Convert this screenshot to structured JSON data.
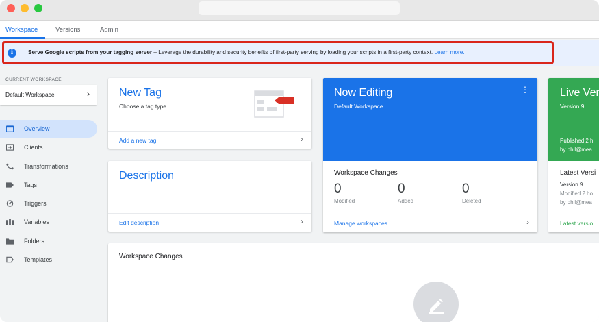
{
  "tabs": [
    {
      "label": "Workspace"
    },
    {
      "label": "Versions"
    },
    {
      "label": "Admin"
    }
  ],
  "banner": {
    "bold_text": "Serve Google scripts from your tagging server",
    "body_text": " – Leverage the durability and security benefits of first-party serving by loading your scripts in a first-party context. ",
    "link_text": "Learn more."
  },
  "sidebar": {
    "workspace_label": "CURRENT WORKSPACE",
    "workspace_name": "Default Workspace",
    "items": [
      {
        "label": "Overview",
        "icon": "overview-icon"
      },
      {
        "label": "Clients",
        "icon": "clients-icon"
      },
      {
        "label": "Transformations",
        "icon": "transformations-icon"
      },
      {
        "label": "Tags",
        "icon": "tag-icon"
      },
      {
        "label": "Triggers",
        "icon": "trigger-icon"
      },
      {
        "label": "Variables",
        "icon": "variables-icon"
      },
      {
        "label": "Folders",
        "icon": "folder-icon"
      },
      {
        "label": "Templates",
        "icon": "template-icon"
      }
    ]
  },
  "new_tag": {
    "title": "New Tag",
    "subtitle": "Choose a tag type",
    "footer_link": "Add a new tag"
  },
  "description": {
    "title": "Description",
    "footer_link": "Edit description"
  },
  "now_editing": {
    "title": "Now Editing",
    "subtitle": "Default Workspace",
    "changes_title": "Workspace Changes",
    "counters": [
      {
        "value": "0",
        "label": "Modified"
      },
      {
        "value": "0",
        "label": "Added"
      },
      {
        "value": "0",
        "label": "Deleted"
      }
    ],
    "footer_link": "Manage workspaces"
  },
  "live_version": {
    "title": "Live Ver",
    "subtitle": "Version 9",
    "published": "Published 2 h",
    "by": "by phil@mea",
    "latest_title": "Latest Versi",
    "latest_version": "Version 9",
    "latest_modified": "Modified 2 ho",
    "latest_by": "by phil@mea",
    "footer_link": "Latest versio"
  },
  "bottom_card": {
    "title": "Workspace Changes"
  },
  "colors": {
    "accent": "#1a73e8",
    "live_green": "#34a853",
    "highlight_red": "#d9261c",
    "banner_bg": "#e8f0fe"
  }
}
